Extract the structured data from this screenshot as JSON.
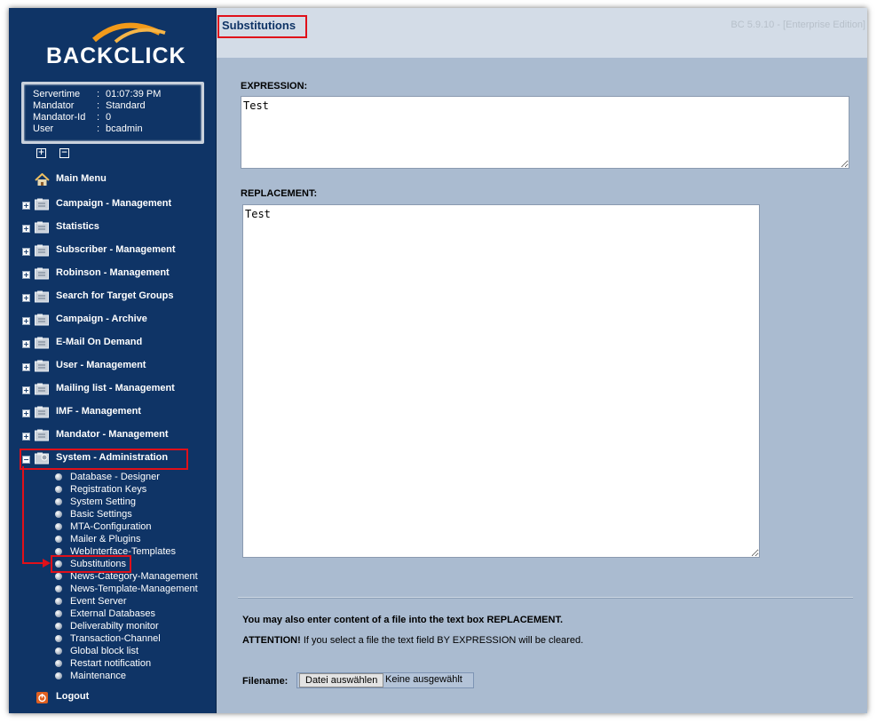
{
  "app": {
    "logo": "BACKCLICK",
    "version": "BC 5.9.10 - [Enterprise Edition]"
  },
  "info": [
    {
      "key": "Servertime",
      "value": "01:07:39 PM"
    },
    {
      "key": "Mandator",
      "value": "Standard"
    },
    {
      "key": "Mandator-Id",
      "value": "0"
    },
    {
      "key": "User",
      "value": "bcadmin"
    }
  ],
  "info_sep": ":",
  "nav": {
    "main_menu": "Main Menu",
    "items": [
      "Campaign - Management",
      "Statistics",
      "Subscriber - Management",
      "Robinson - Management",
      "Search for Target Groups",
      "Campaign - Archive",
      "E-Mail On Demand",
      "User - Management",
      "Mailing list - Management",
      "IMF - Management",
      "Mandator - Management",
      "System - Administration"
    ],
    "sub_items": [
      "Database - Designer",
      "Registration Keys",
      "System Setting",
      "Basic Settings",
      "MTA-Configuration",
      "Mailer & Plugins",
      "WebInterface-Templates",
      "Substitutions",
      "News-Category-Management",
      "News-Template-Management",
      "Event Server",
      "External Databases",
      "Deliverabilty monitor",
      "Transaction-Channel",
      "Global block list",
      "Restart notification",
      "Maintenance"
    ],
    "logout": "Logout"
  },
  "page": {
    "title": "Substitutions",
    "expression_label": "EXPRESSION:",
    "expression_value": "Test",
    "replacement_label": "REPLACEMENT:",
    "replacement_value": "Test",
    "note_file": "You may also enter content of a file into the text box REPLACEMENT.",
    "attention_label": "ATTENTION!",
    "attention_text": " If you select a file the text field BY EXPRESSION will be cleared.",
    "filename_label": "Filename:",
    "file_button": "Datei auswählen",
    "file_none": "Keine ausgewählt"
  },
  "colors": {
    "sidebar": "#0f3466",
    "content": "#aabbd0",
    "highlight": "#e0101a",
    "title": "#0f3466"
  }
}
